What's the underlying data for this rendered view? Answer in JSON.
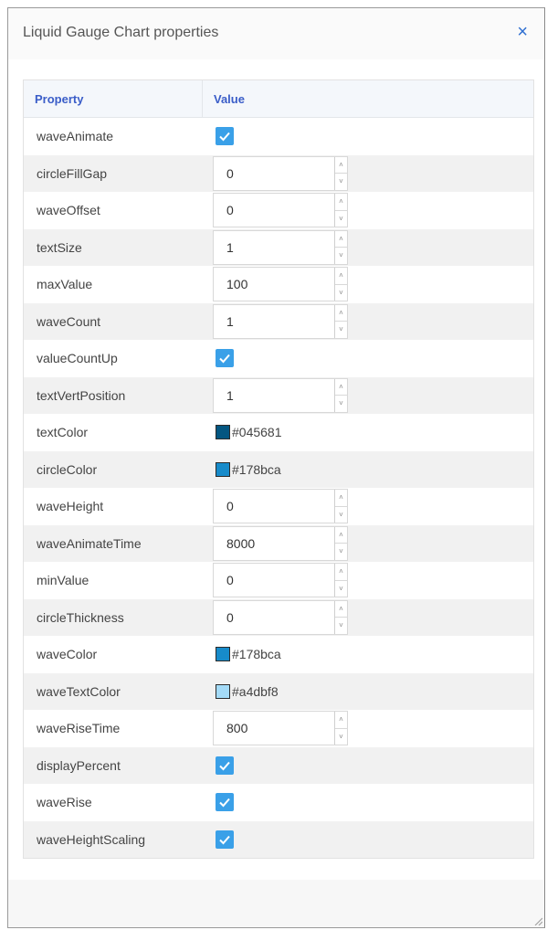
{
  "dialog": {
    "title": "Liquid Gauge Chart properties",
    "close_symbol": "×",
    "close_icon": "close-icon"
  },
  "table": {
    "header_property": "Property",
    "header_value": "Value",
    "rows": [
      {
        "name": "waveAnimate",
        "type": "checkbox",
        "checked": true
      },
      {
        "name": "circleFillGap",
        "type": "number",
        "value": "0"
      },
      {
        "name": "waveOffset",
        "type": "number",
        "value": "0"
      },
      {
        "name": "textSize",
        "type": "number",
        "value": "1"
      },
      {
        "name": "maxValue",
        "type": "number",
        "value": "100"
      },
      {
        "name": "waveCount",
        "type": "number",
        "value": "1"
      },
      {
        "name": "valueCountUp",
        "type": "checkbox",
        "checked": true
      },
      {
        "name": "textVertPosition",
        "type": "number",
        "value": "1"
      },
      {
        "name": "textColor",
        "type": "color",
        "value": "#045681"
      },
      {
        "name": "circleColor",
        "type": "color",
        "value": "#178bca"
      },
      {
        "name": "waveHeight",
        "type": "number",
        "value": "0"
      },
      {
        "name": "waveAnimateTime",
        "type": "number",
        "value": "8000"
      },
      {
        "name": "minValue",
        "type": "number",
        "value": "0"
      },
      {
        "name": "circleThickness",
        "type": "number",
        "value": "0"
      },
      {
        "name": "waveColor",
        "type": "color",
        "value": "#178bca"
      },
      {
        "name": "waveTextColor",
        "type": "color",
        "value": "#a4dbf8"
      },
      {
        "name": "waveRiseTime",
        "type": "number",
        "value": "800"
      },
      {
        "name": "displayPercent",
        "type": "checkbox",
        "checked": true
      },
      {
        "name": "waveRise",
        "type": "checkbox",
        "checked": true
      },
      {
        "name": "waveHeightScaling",
        "type": "checkbox",
        "checked": true
      }
    ]
  },
  "colors": {
    "checkbox": "#3aa0e8",
    "header_text": "#3a5dc8",
    "close": "#2f6fd1"
  }
}
